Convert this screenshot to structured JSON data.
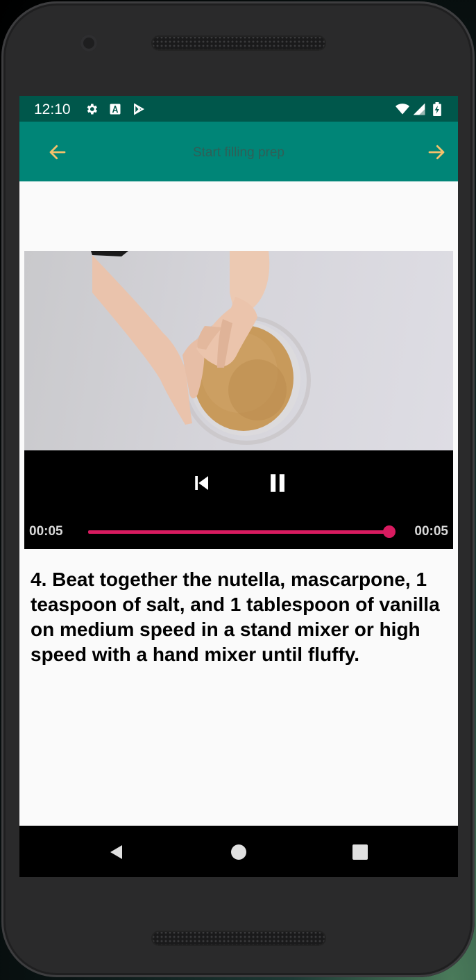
{
  "status_bar": {
    "time": "12:10",
    "icons": [
      "gear-icon",
      "a-box-icon",
      "play-store-icon"
    ],
    "right_icons": [
      "wifi-icon",
      "signal-icon",
      "battery-icon"
    ]
  },
  "app_bar": {
    "title": "Start filling prep",
    "back_icon": "arrow-left-icon",
    "next_icon": "arrow-right-icon",
    "background": "#008577",
    "icon_color": "#f4c16b"
  },
  "player": {
    "controls": [
      "skip-previous-icon",
      "pause-icon"
    ],
    "position": "00:05",
    "duration": "00:05",
    "progress": 1.0,
    "accent": "#d81b60"
  },
  "step": {
    "description": "4. Beat together the nutella, mascarpone, 1 teaspoon of salt, and 1 tablespoon of vanilla on medium speed in a stand mixer or high speed with a hand mixer until fluffy."
  },
  "nav_bar": {
    "buttons": [
      "back-triangle-icon",
      "home-circle-icon",
      "recents-square-icon"
    ]
  }
}
